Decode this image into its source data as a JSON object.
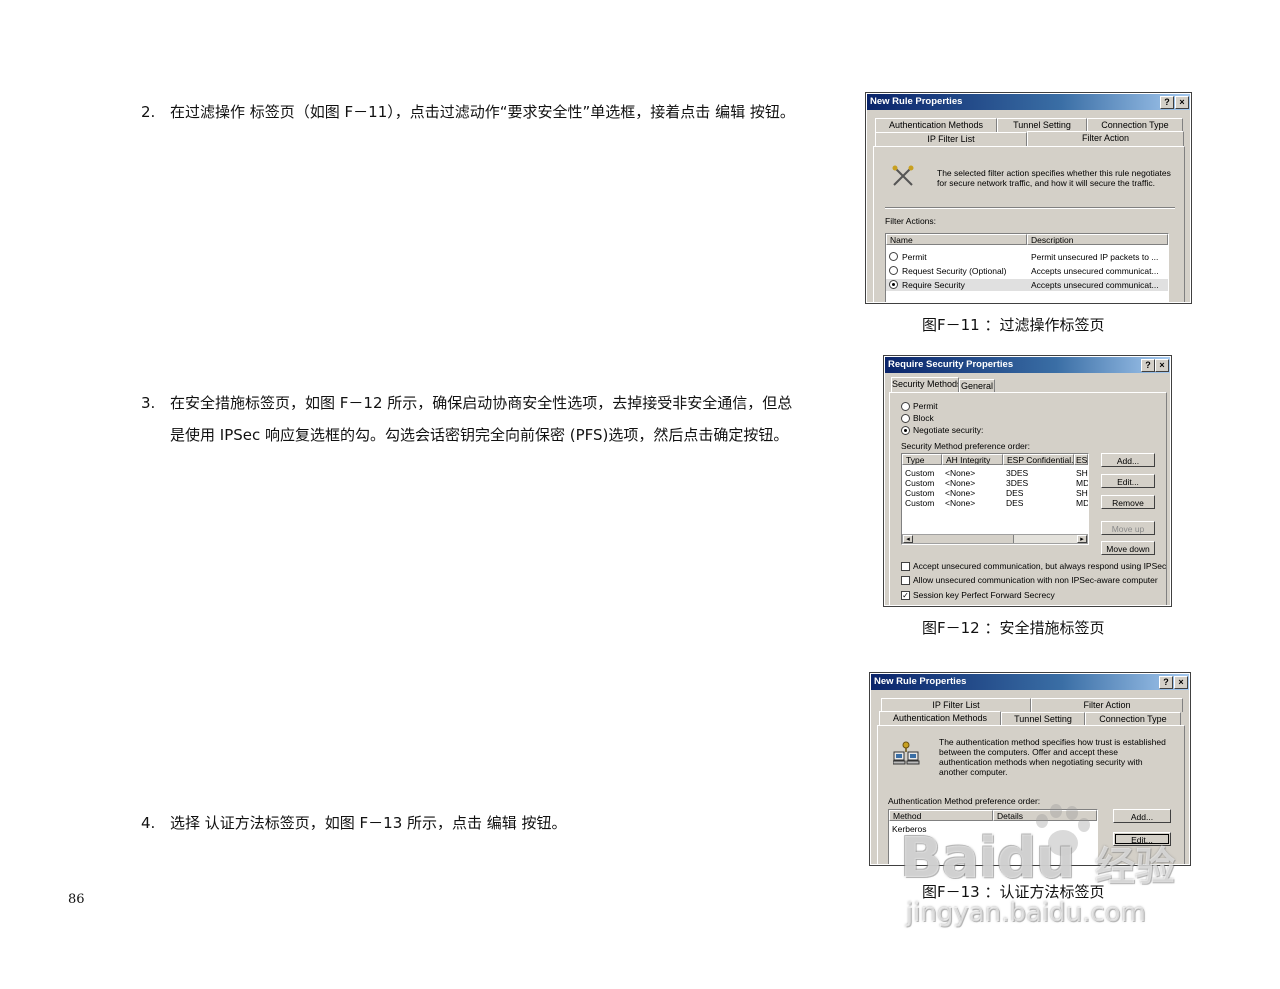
{
  "steps": [
    {
      "num": "2.",
      "text": "在过滤操作 标签页（如图 F－11），点击过滤动作“要求安全性”单选框，接着点击 编辑 按钮。"
    },
    {
      "num": "3.",
      "text": "在安全措施标签页，如图 F－12 所示，确保启动协商安全性选项，去掉接受非安全通信，但总是使用 IPSec 响应复选框的勾。勾选会话密钥完全向前保密 (PFS)选项，然后点击确定按钮。"
    },
    {
      "num": "4.",
      "text": "选择 认证方法标签页，如图 F－13 所示，点击 编辑 按钮。"
    }
  ],
  "captions": [
    "图F－11 ：过滤操作标签页",
    "图F－12 ：安全措施标签页",
    "图F－13 ：认证方法标签页"
  ],
  "page_number": "86",
  "fig11": {
    "title": "New Rule Properties",
    "help": "?",
    "close": "×",
    "tabs_back": [
      "Authentication Methods",
      "Tunnel Setting",
      "Connection Type"
    ],
    "tabs_front": [
      "IP Filter List",
      "Filter Action"
    ],
    "description": "The selected filter action specifies whether this rule negotiates for secure network traffic, and how it will secure the traffic.",
    "section_label": "Filter Actions:",
    "columns": [
      "Name",
      "Description"
    ],
    "rows": [
      {
        "name": "Permit",
        "desc": "Permit unsecured IP packets to ...",
        "selected": false
      },
      {
        "name": "Request Security (Optional)",
        "desc": "Accepts unsecured communicat...",
        "selected": false
      },
      {
        "name": "Require Security",
        "desc": "Accepts unsecured communicat...",
        "selected": true
      }
    ]
  },
  "fig12": {
    "title": "Require Security Properties",
    "help": "?",
    "close": "×",
    "tabs": [
      "Security Methods",
      "General"
    ],
    "options": [
      {
        "label": "Permit",
        "selected": false
      },
      {
        "label": "Block",
        "selected": false
      },
      {
        "label": "Negotiate security:",
        "selected": true
      }
    ],
    "list_label": "Security Method preference order:",
    "columns": [
      "Type",
      "AH Integrity",
      "ESP Confidential...",
      "ES"
    ],
    "rows": [
      [
        "Custom",
        "<None>",
        "3DES",
        "SH"
      ],
      [
        "Custom",
        "<None>",
        "3DES",
        "MD"
      ],
      [
        "Custom",
        "<None>",
        "DES",
        "SH"
      ],
      [
        "Custom",
        "<None>",
        "DES",
        "MD"
      ]
    ],
    "buttons": [
      "Add...",
      "Edit...",
      "Remove",
      "Move up",
      "Move down"
    ],
    "scroll_left": "◂",
    "scroll_right": "▸",
    "checkboxes": [
      {
        "label": "Accept unsecured communication, but always respond using IPSec",
        "checked": false
      },
      {
        "label": "Allow unsecured communication with non IPSec-aware computer",
        "checked": false
      },
      {
        "label": "Session key Perfect Forward Secrecy",
        "checked": true
      }
    ],
    "check_mark": "✓"
  },
  "fig13": {
    "title": "New Rule Properties",
    "help": "?",
    "close": "×",
    "tabs_back": [
      "IP Filter List",
      "Filter Action"
    ],
    "tabs_front": [
      "Authentication Methods",
      "Tunnel Setting",
      "Connection Type"
    ],
    "description": "The authentication method specifies how trust is established between the computers. Offer and accept these authentication methods when negotiating security with another computer.",
    "list_label": "Authentication Method preference order:",
    "columns": [
      "Method",
      "Details"
    ],
    "rows": [
      [
        "Kerberos",
        ""
      ]
    ],
    "buttons": [
      "Add...",
      "Edit..."
    ]
  },
  "watermark": {
    "logo": "Baidu",
    "suffix": "经验",
    "url": "jingyan.baidu.com"
  }
}
